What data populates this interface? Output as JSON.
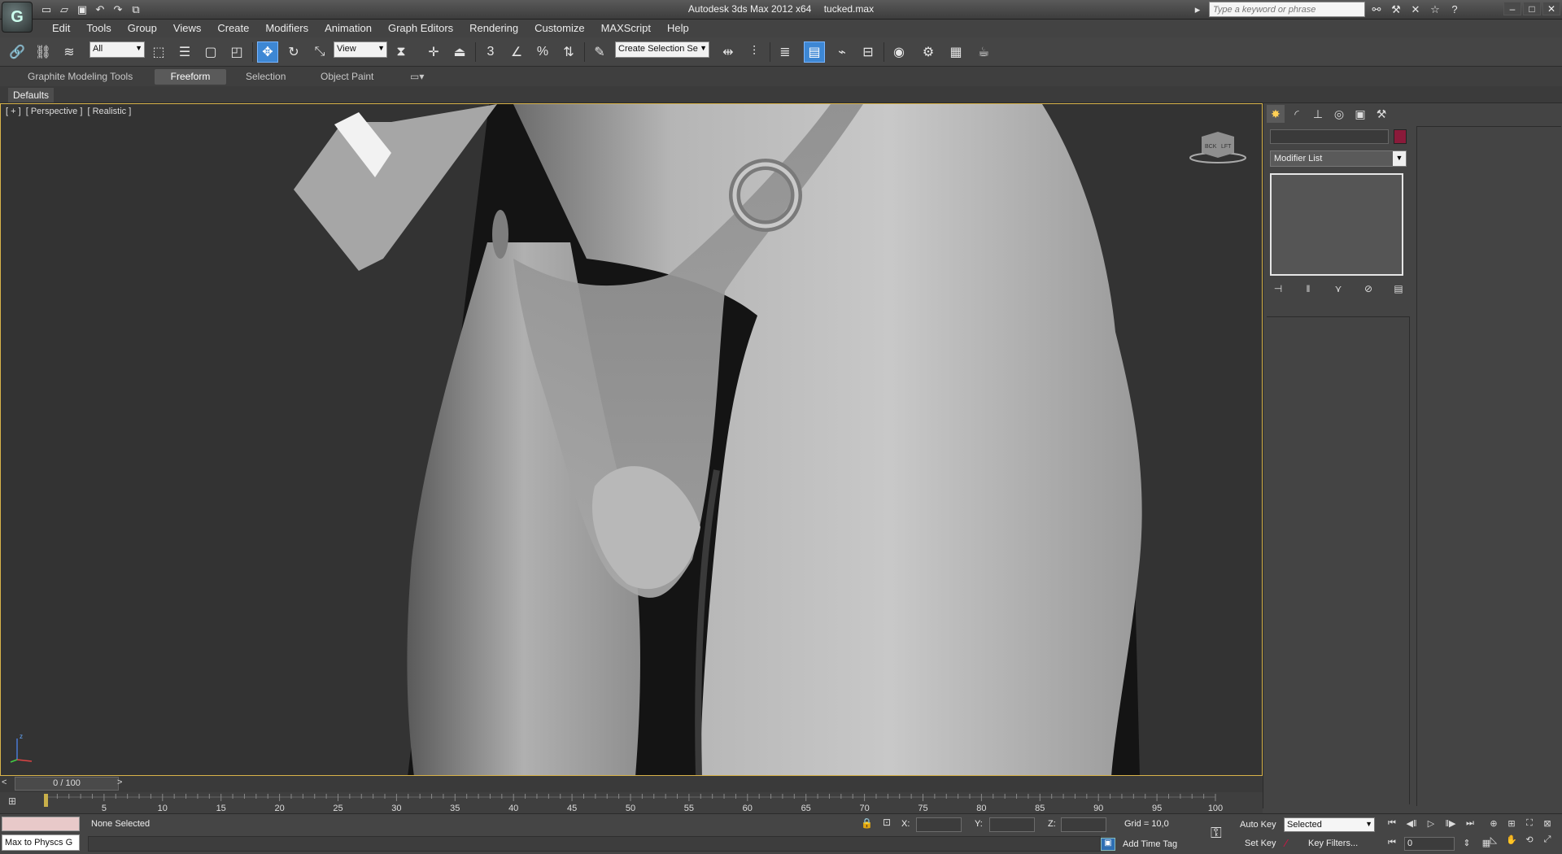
{
  "window": {
    "app_title": "Autodesk 3ds Max  2012 x64",
    "file_name": "tucked.max",
    "search_placeholder": "Type a keyword or phrase"
  },
  "quick_access": [
    "new-file",
    "open-file",
    "save-file",
    "undo",
    "redo",
    "project-folder"
  ],
  "menu": [
    "Edit",
    "Tools",
    "Group",
    "Views",
    "Create",
    "Modifiers",
    "Animation",
    "Graph Editors",
    "Rendering",
    "Customize",
    "MAXScript",
    "Help"
  ],
  "toolbar": {
    "selection_filter": "All",
    "reference_coord": "View",
    "named_selection": "Create Selection Se",
    "snaps_toggle_label": "3",
    "percent_snap_label": "%"
  },
  "ribbon": {
    "tabs": [
      "Graphite Modeling Tools",
      "Freeform",
      "Selection",
      "Object Paint"
    ],
    "active_tab": "Freeform",
    "panel_tab": "Defaults"
  },
  "viewport": {
    "labels": [
      "[ + ]",
      "[ Perspective ]",
      "[ Realistic ]"
    ],
    "viewcube_labels": [
      "BCK",
      "LFT"
    ],
    "axis_label": "z"
  },
  "command_panel": {
    "modifier_list": "Modifier List",
    "object_color": "#8a1a3a"
  },
  "time_slider": {
    "frame_display": "0 / 100",
    "left_arrow": "<",
    "right_arrow": ">"
  },
  "trackbar": {
    "ticks": [
      5,
      10,
      15,
      20,
      25,
      30,
      35,
      40,
      45,
      50,
      55,
      60,
      65,
      70,
      75,
      80,
      85,
      90,
      95,
      100
    ],
    "current_frame": 0,
    "frame_count": 100
  },
  "status": {
    "maxscript_listener": "Max to Physcs G",
    "prompt": "None Selected",
    "x_label": "X:",
    "y_label": "Y:",
    "z_label": "Z:",
    "grid": "Grid = 10,0",
    "add_time_tag": "Add Time Tag",
    "auto_key": "Auto Key",
    "set_key": "Set Key",
    "key_mode": "Selected",
    "key_filters": "Key Filters...",
    "current_frame": "0"
  },
  "colors": {
    "viewport_border": "#d8b34a",
    "active_tool": "#3d87d4"
  }
}
